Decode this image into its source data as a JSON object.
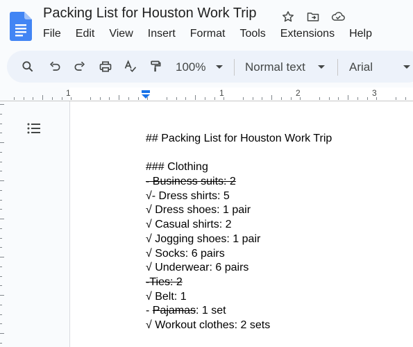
{
  "header": {
    "title": "Packing List for Houston Work Trip",
    "title_icons": [
      "star-icon",
      "move-to-folder-icon",
      "cloud-status-icon"
    ]
  },
  "menu": {
    "items": [
      "File",
      "Edit",
      "View",
      "Insert",
      "Format",
      "Tools",
      "Extensions",
      "Help"
    ]
  },
  "toolbar": {
    "zoom": "100%",
    "style": "Normal text",
    "font": "Arial",
    "icons": [
      "search-icon",
      "undo-icon",
      "redo-icon",
      "print-icon",
      "spellcheck-icon",
      "paint-format-icon"
    ]
  },
  "ruler": {
    "numbers": [
      "1",
      "1",
      "2",
      "3"
    ]
  },
  "document": {
    "heading": "## Packing List for Houston Work Trip",
    "subheading": "### Clothing",
    "lines": [
      {
        "parts": [
          {
            "text": "- Business suits: 2",
            "strike": true
          }
        ]
      },
      {
        "parts": [
          {
            "text": "√- Dress shirts: 5",
            "strike": false
          }
        ]
      },
      {
        "parts": [
          {
            "text": "√ Dress shoes: 1 pair",
            "strike": false
          }
        ]
      },
      {
        "parts": [
          {
            "text": "√ Casual shirts: 2",
            "strike": false
          }
        ]
      },
      {
        "parts": [
          {
            "text": "√ Jogging shoes: 1 pair",
            "strike": false
          }
        ]
      },
      {
        "parts": [
          {
            "text": "√ Socks: 6 pairs",
            "strike": false
          }
        ]
      },
      {
        "parts": [
          {
            "text": "√ Underwear: 6 pairs",
            "strike": false
          }
        ]
      },
      {
        "parts": [
          {
            "text": "-Ties: 2",
            "strike": true
          }
        ]
      },
      {
        "parts": [
          {
            "text": "√ Belt: 1",
            "strike": false
          }
        ]
      },
      {
        "parts": [
          {
            "text": "- ",
            "strike": false
          },
          {
            "text": "Pajamas",
            "strike": true
          },
          {
            "text": ": 1 set",
            "strike": false
          }
        ]
      },
      {
        "parts": [
          {
            "text": "√ Workout clothes: 2 sets",
            "strike": false
          }
        ]
      }
    ]
  },
  "colors": {
    "docs_blue": "#4285f4",
    "toolbar_bg": "#edf2fa",
    "app_bg": "#f9fbfd",
    "marker_blue": "#1a73e8"
  }
}
